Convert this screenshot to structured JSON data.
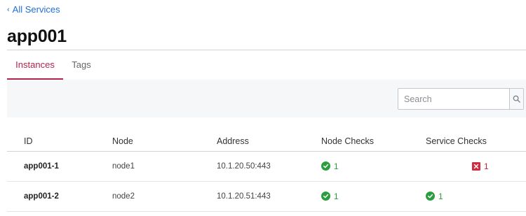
{
  "breadcrumb": {
    "back_label": "All Services"
  },
  "page": {
    "title": "app001"
  },
  "tabs": [
    {
      "label": "Instances",
      "active": true
    },
    {
      "label": "Tags",
      "active": false
    }
  ],
  "search": {
    "placeholder": "Search",
    "value": ""
  },
  "table": {
    "columns": [
      "ID",
      "Node",
      "Address",
      "Node Checks",
      "Service Checks"
    ],
    "rows": [
      {
        "id": "app001-1",
        "node": "node1",
        "address": "10.1.20.50:443",
        "node_checks": {
          "status": "passing",
          "count": "1"
        },
        "service_checks": {
          "status": "critical",
          "count": "1"
        }
      },
      {
        "id": "app001-2",
        "node": "node2",
        "address": "10.1.20.51:443",
        "node_checks": {
          "status": "passing",
          "count": "1"
        },
        "service_checks": {
          "status": "passing",
          "count": "1"
        }
      }
    ]
  },
  "colors": {
    "accent": "#b0244d",
    "link": "#1f6fd6",
    "passing": "#2a9d3e",
    "critical": "#d22a3f"
  },
  "icons": {
    "back": "chevron-left-icon",
    "search": "search-icon",
    "passing": "check-circle-icon",
    "critical": "x-square-icon"
  }
}
